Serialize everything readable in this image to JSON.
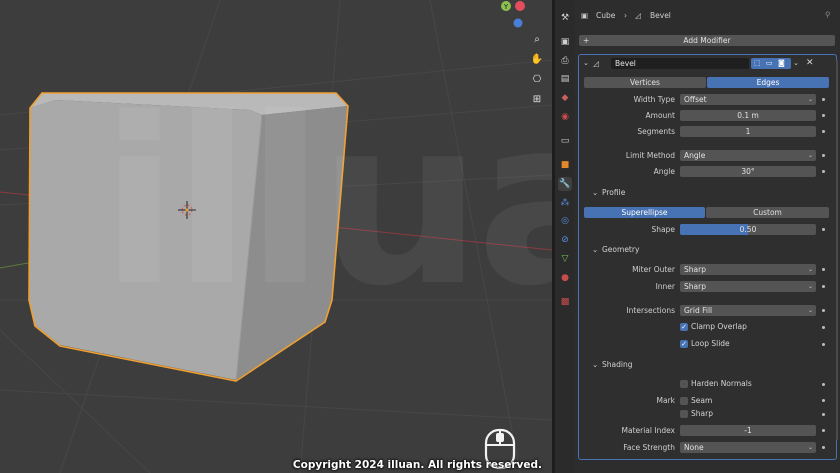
{
  "watermark": "illuan",
  "copyright": "Copyright 2024 illuan. All rights reserved.",
  "gizmo": {
    "y_axis": "Y"
  },
  "breadcrumb": {
    "object": "Cube",
    "modifier": "Bevel"
  },
  "add_modifier": "Add Modifier",
  "modifier": {
    "name": "Bevel",
    "affect_tabs": [
      "Vertices",
      "Edges"
    ],
    "width_type": {
      "label": "Width Type",
      "value": "Offset"
    },
    "amount": {
      "label": "Amount",
      "value": "0.1 m"
    },
    "segments": {
      "label": "Segments",
      "value": "1"
    },
    "limit_method": {
      "label": "Limit Method",
      "value": "Angle"
    },
    "angle": {
      "label": "Angle",
      "value": "30°"
    },
    "profile": {
      "title": "Profile",
      "tabs": [
        "Superellipse",
        "Custom"
      ],
      "shape": {
        "label": "Shape",
        "value": "0.50",
        "fill": 0.5
      }
    },
    "geometry": {
      "title": "Geometry",
      "miter_outer": {
        "label": "Miter Outer",
        "value": "Sharp"
      },
      "inner": {
        "label": "Inner",
        "value": "Sharp"
      },
      "intersections": {
        "label": "Intersections",
        "value": "Grid Fill"
      },
      "clamp_overlap": "Clamp Overlap",
      "loop_slide": "Loop Slide"
    },
    "shading": {
      "title": "Shading",
      "harden_normals": "Harden Normals",
      "mark_label": "Mark",
      "seam": "Seam",
      "sharp": "Sharp",
      "material_index": {
        "label": "Material Index",
        "value": "-1"
      },
      "face_strength": {
        "label": "Face Strength",
        "value": "None"
      }
    }
  },
  "colors": {
    "accent": "#4772b3",
    "selection_outline": "#f0a030",
    "x_axis": "#e44d5c",
    "y_axis": "#8cc04f"
  }
}
